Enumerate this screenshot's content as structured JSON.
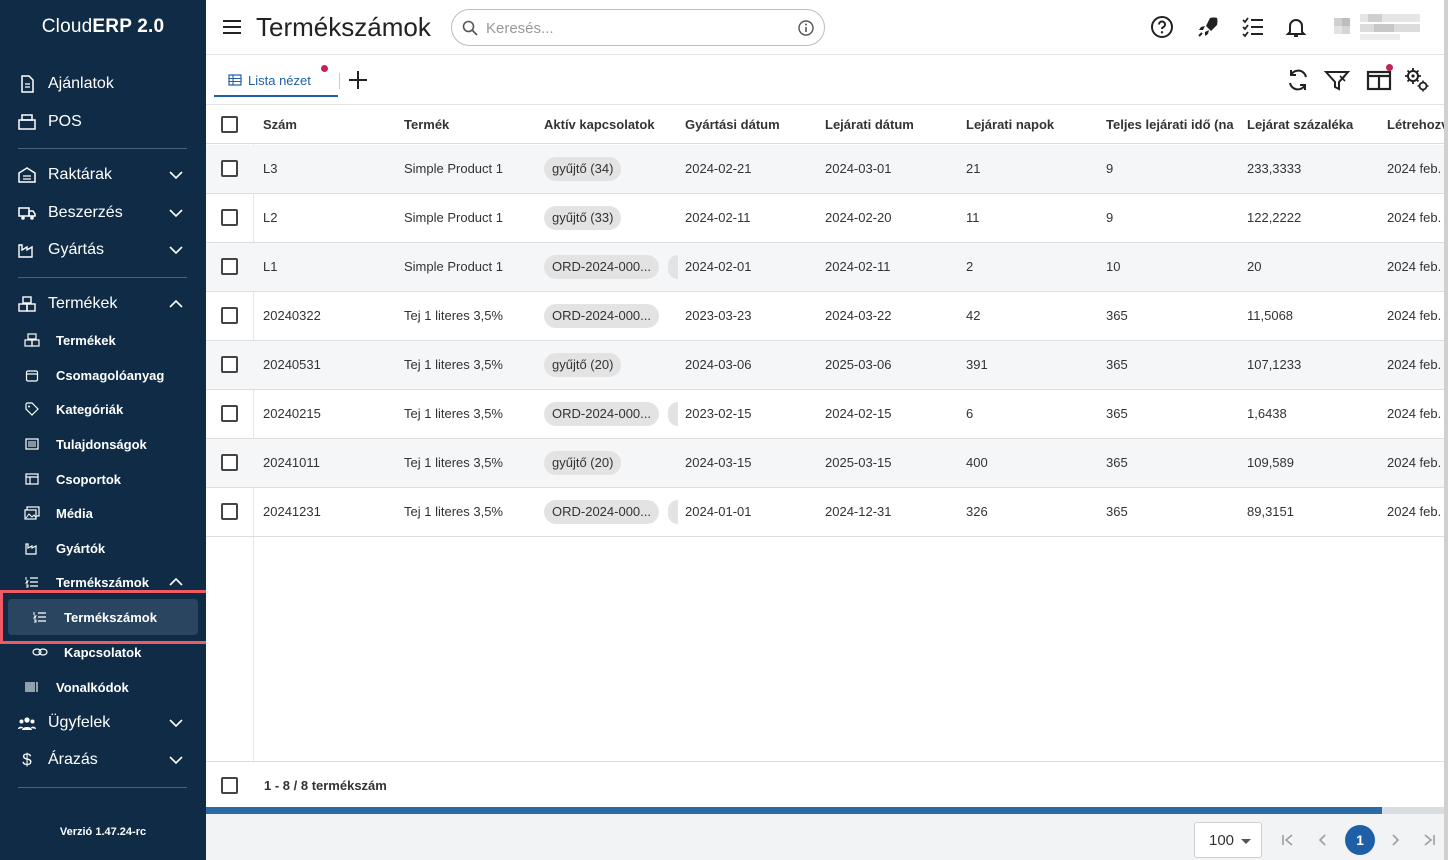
{
  "app": {
    "brand_plain": "Cloud",
    "brand_bold": "ERP 2.0",
    "version": "Verzió 1.47.24-rc"
  },
  "sidebar": {
    "main_items": [
      {
        "label": "Ajánlatok",
        "icon": "document-icon"
      },
      {
        "label": "POS",
        "icon": "register-icon"
      },
      {
        "label": "Raktárak",
        "icon": "warehouse-icon"
      },
      {
        "label": "Beszerzés",
        "icon": "truck-icon"
      },
      {
        "label": "Gyártás",
        "icon": "factory-icon"
      },
      {
        "label": "Termékek",
        "icon": "boxes-icon"
      }
    ],
    "termekek_children": [
      {
        "label": "Termékek",
        "icon": "boxes-icon"
      },
      {
        "label": "Csomagolóanyag",
        "icon": "package-icon"
      },
      {
        "label": "Kategóriák",
        "icon": "tag-icon"
      },
      {
        "label": "Tulajdonságok",
        "icon": "list-icon"
      },
      {
        "label": "Csoportok",
        "icon": "group-icon"
      },
      {
        "label": "Média",
        "icon": "media-icon"
      },
      {
        "label": "Gyártók",
        "icon": "factory-icon"
      },
      {
        "label": "Termékszámok",
        "icon": "numbered-list-icon"
      }
    ],
    "termekszamok_children": [
      {
        "label": "Termékszámok",
        "icon": "numbered-list-icon",
        "active": true
      },
      {
        "label": "Kapcsolatok",
        "icon": "link-icon"
      }
    ],
    "after_items": [
      {
        "label": "Vonalkódok",
        "icon": "barcode-icon"
      },
      {
        "label": "Ügyfelek",
        "icon": "people-icon"
      },
      {
        "label": "Árazás",
        "icon": "dollar-icon"
      }
    ]
  },
  "header": {
    "title": "Termékszámok",
    "search_placeholder": "Keresés..."
  },
  "tabs": [
    {
      "label": "Lista nézet"
    }
  ],
  "table": {
    "columns": [
      "Szám",
      "Termék",
      "Aktív kapcsolatok",
      "Gyártási dátum",
      "Lejárati dátum",
      "Lejárati napok",
      "Teljes lejárati idő (na",
      "Lejárat százaléka",
      "Létrehozv"
    ],
    "rows": [
      {
        "szam": "L3",
        "termek": "Simple Product 1",
        "kapcs": "gyűjtő (34)",
        "peek": false,
        "gyart": "2024-02-21",
        "lejar": "2024-03-01",
        "napok": "21",
        "teljes": "9",
        "szazalek": "233,3333",
        "letrehozva": "2024 feb."
      },
      {
        "szam": "L2",
        "termek": "Simple Product 1",
        "kapcs": "gyűjtő (33)",
        "peek": false,
        "gyart": "2024-02-11",
        "lejar": "2024-02-20",
        "napok": "11",
        "teljes": "9",
        "szazalek": "122,2222",
        "letrehozva": "2024 feb."
      },
      {
        "szam": "L1",
        "termek": "Simple Product 1",
        "kapcs": "ORD-2024-000...",
        "peek": true,
        "gyart": "2024-02-01",
        "lejar": "2024-02-11",
        "napok": "2",
        "teljes": "10",
        "szazalek": "20",
        "letrehozva": "2024 feb."
      },
      {
        "szam": "20240322",
        "termek": "Tej 1 literes 3,5%",
        "kapcs": "ORD-2024-000...",
        "peek": false,
        "gyart": "2023-03-23",
        "lejar": "2024-03-22",
        "napok": "42",
        "teljes": "365",
        "szazalek": "11,5068",
        "letrehozva": "2024 feb."
      },
      {
        "szam": "20240531",
        "termek": "Tej 1 literes 3,5%",
        "kapcs": "gyűjtő (20)",
        "peek": false,
        "gyart": "2024-03-06",
        "lejar": "2025-03-06",
        "napok": "391",
        "teljes": "365",
        "szazalek": "107,1233",
        "letrehozva": "2024 feb."
      },
      {
        "szam": "20240215",
        "termek": "Tej 1 literes 3,5%",
        "kapcs": "ORD-2024-000...",
        "peek": true,
        "gyart": "2023-02-15",
        "lejar": "2024-02-15",
        "napok": "6",
        "teljes": "365",
        "szazalek": "1,6438",
        "letrehozva": "2024 feb."
      },
      {
        "szam": "20241011",
        "termek": "Tej 1 literes 3,5%",
        "kapcs": "gyűjtő (20)",
        "peek": false,
        "gyart": "2024-03-15",
        "lejar": "2025-03-15",
        "napok": "400",
        "teljes": "365",
        "szazalek": "109,589",
        "letrehozva": "2024 feb."
      },
      {
        "szam": "20241231",
        "termek": "Tej 1 literes 3,5%",
        "kapcs": "ORD-2024-000...",
        "peek": true,
        "gyart": "2024-01-01",
        "lejar": "2024-12-31",
        "napok": "326",
        "teljes": "365",
        "szazalek": "89,3151",
        "letrehozva": "2024 feb."
      }
    ]
  },
  "footer": {
    "count_label": "1 - 8 / 8 termékszám",
    "page_size": "100",
    "current_page": "1"
  },
  "colors": {
    "sidebar_bg": "#0f2b46",
    "accent": "#1e5fa8",
    "highlight": "#f05a64",
    "notification_dot": "#c0245c"
  }
}
